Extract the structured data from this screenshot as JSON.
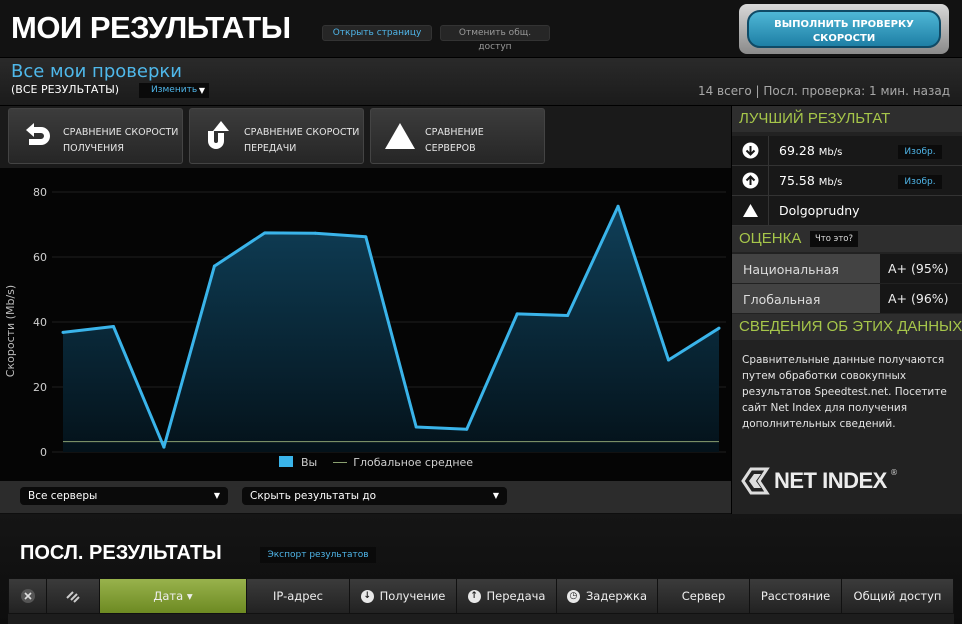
{
  "header": {
    "title": "МОИ РЕЗУЛЬТАТЫ",
    "open_page": "Открыть страницу",
    "cancel_share": "Отменить общ. доступ",
    "run_test": "ВЫПОЛНИТЬ ПРОВЕРКУ СКОРОСТИ"
  },
  "subheader": {
    "title": "Все мои проверки",
    "filter": "(ВСЕ РЕЗУЛЬТАТЫ)",
    "change": "Изменить",
    "stats": "14 всего | Посл. проверка: 1 мин. назад"
  },
  "compare_tabs": [
    {
      "line1": "Сравнение скорости",
      "line2": "получения",
      "icon": "download-compare-icon"
    },
    {
      "line1": "Сравнение скорости",
      "line2": "передачи",
      "icon": "upload-compare-icon"
    },
    {
      "line1": "Сравнение",
      "line2": "серверов",
      "icon": "server-triangle-icon"
    }
  ],
  "chart_data": {
    "type": "area",
    "ylabel": "Скорости (Mb/s)",
    "ylim": [
      0,
      80
    ],
    "yticks": [
      0,
      20,
      40,
      60,
      80
    ],
    "series": [
      {
        "name": "Вы",
        "color": "#3ab4ea",
        "values": [
          36.8,
          38.6,
          1.5,
          57.2,
          67.4,
          67.3,
          66.2,
          7.7,
          7.0,
          42.5,
          42.0,
          75.6,
          28.3,
          38.1
        ]
      },
      {
        "name": "Глобальное среднее",
        "color": "#8aa070",
        "values": [
          3.2
        ]
      }
    ],
    "legend": [
      "Вы",
      "Глобальное среднее"
    ]
  },
  "filters": {
    "servers": "Все серверы",
    "hide": "Скрыть результаты до"
  },
  "best": {
    "title": "ЛУЧШИЙ РЕЗУЛЬТАТ",
    "download_value": "69.28",
    "download_unit": "Mb/s",
    "upload_value": "75.58",
    "upload_unit": "Mb/s",
    "server": "Dolgoprudny",
    "image_label": "Изобр."
  },
  "grade": {
    "title": "ОЦЕНКА",
    "what": "Что это?",
    "rows": [
      {
        "name": "Национальная",
        "grade": "A+ (95%)"
      },
      {
        "name": "Глобальная",
        "grade": "A+ (96%)"
      }
    ]
  },
  "about": {
    "title": "СВЕДЕНИЯ ОБ ЭТИХ ДАННЫХ",
    "text": "Сравнительные данные получаются путем обработки совокупных результатов Speedtest.net. Посетите сайт Net Index для получения дополнительных сведений.",
    "logo": "NET INDEX"
  },
  "last_results": {
    "title": "ПОСЛ. РЕЗУЛЬТАТЫ",
    "export": "Экспорт результатов",
    "columns": [
      "Дата ▾",
      "IP-адрес",
      "Получение",
      "Передача",
      "Задержка",
      "Сервер",
      "Расстояние",
      "Общий доступ"
    ]
  }
}
